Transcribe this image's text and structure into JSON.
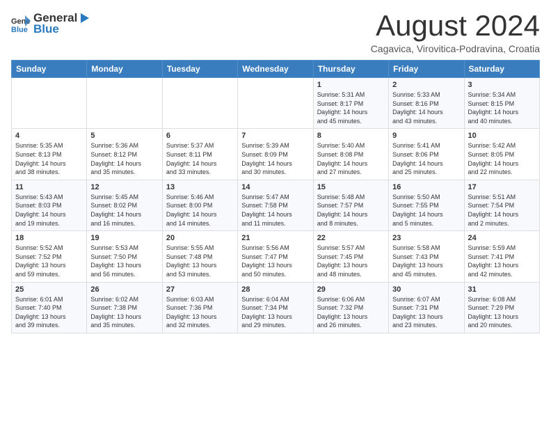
{
  "header": {
    "logo": {
      "text1": "General",
      "text2": "Blue"
    },
    "title": "August 2024",
    "location": "Cagavica, Virovitica-Podravina, Croatia"
  },
  "weekdays": [
    "Sunday",
    "Monday",
    "Tuesday",
    "Wednesday",
    "Thursday",
    "Friday",
    "Saturday"
  ],
  "weeks": [
    [
      {
        "day": "",
        "info": ""
      },
      {
        "day": "",
        "info": ""
      },
      {
        "day": "",
        "info": ""
      },
      {
        "day": "",
        "info": ""
      },
      {
        "day": "1",
        "info": "Sunrise: 5:31 AM\nSunset: 8:17 PM\nDaylight: 14 hours\nand 45 minutes."
      },
      {
        "day": "2",
        "info": "Sunrise: 5:33 AM\nSunset: 8:16 PM\nDaylight: 14 hours\nand 43 minutes."
      },
      {
        "day": "3",
        "info": "Sunrise: 5:34 AM\nSunset: 8:15 PM\nDaylight: 14 hours\nand 40 minutes."
      }
    ],
    [
      {
        "day": "4",
        "info": "Sunrise: 5:35 AM\nSunset: 8:13 PM\nDaylight: 14 hours\nand 38 minutes."
      },
      {
        "day": "5",
        "info": "Sunrise: 5:36 AM\nSunset: 8:12 PM\nDaylight: 14 hours\nand 35 minutes."
      },
      {
        "day": "6",
        "info": "Sunrise: 5:37 AM\nSunset: 8:11 PM\nDaylight: 14 hours\nand 33 minutes."
      },
      {
        "day": "7",
        "info": "Sunrise: 5:39 AM\nSunset: 8:09 PM\nDaylight: 14 hours\nand 30 minutes."
      },
      {
        "day": "8",
        "info": "Sunrise: 5:40 AM\nSunset: 8:08 PM\nDaylight: 14 hours\nand 27 minutes."
      },
      {
        "day": "9",
        "info": "Sunrise: 5:41 AM\nSunset: 8:06 PM\nDaylight: 14 hours\nand 25 minutes."
      },
      {
        "day": "10",
        "info": "Sunrise: 5:42 AM\nSunset: 8:05 PM\nDaylight: 14 hours\nand 22 minutes."
      }
    ],
    [
      {
        "day": "11",
        "info": "Sunrise: 5:43 AM\nSunset: 8:03 PM\nDaylight: 14 hours\nand 19 minutes."
      },
      {
        "day": "12",
        "info": "Sunrise: 5:45 AM\nSunset: 8:02 PM\nDaylight: 14 hours\nand 16 minutes."
      },
      {
        "day": "13",
        "info": "Sunrise: 5:46 AM\nSunset: 8:00 PM\nDaylight: 14 hours\nand 14 minutes."
      },
      {
        "day": "14",
        "info": "Sunrise: 5:47 AM\nSunset: 7:58 PM\nDaylight: 14 hours\nand 11 minutes."
      },
      {
        "day": "15",
        "info": "Sunrise: 5:48 AM\nSunset: 7:57 PM\nDaylight: 14 hours\nand 8 minutes."
      },
      {
        "day": "16",
        "info": "Sunrise: 5:50 AM\nSunset: 7:55 PM\nDaylight: 14 hours\nand 5 minutes."
      },
      {
        "day": "17",
        "info": "Sunrise: 5:51 AM\nSunset: 7:54 PM\nDaylight: 14 hours\nand 2 minutes."
      }
    ],
    [
      {
        "day": "18",
        "info": "Sunrise: 5:52 AM\nSunset: 7:52 PM\nDaylight: 13 hours\nand 59 minutes."
      },
      {
        "day": "19",
        "info": "Sunrise: 5:53 AM\nSunset: 7:50 PM\nDaylight: 13 hours\nand 56 minutes."
      },
      {
        "day": "20",
        "info": "Sunrise: 5:55 AM\nSunset: 7:48 PM\nDaylight: 13 hours\nand 53 minutes."
      },
      {
        "day": "21",
        "info": "Sunrise: 5:56 AM\nSunset: 7:47 PM\nDaylight: 13 hours\nand 50 minutes."
      },
      {
        "day": "22",
        "info": "Sunrise: 5:57 AM\nSunset: 7:45 PM\nDaylight: 13 hours\nand 48 minutes."
      },
      {
        "day": "23",
        "info": "Sunrise: 5:58 AM\nSunset: 7:43 PM\nDaylight: 13 hours\nand 45 minutes."
      },
      {
        "day": "24",
        "info": "Sunrise: 5:59 AM\nSunset: 7:41 PM\nDaylight: 13 hours\nand 42 minutes."
      }
    ],
    [
      {
        "day": "25",
        "info": "Sunrise: 6:01 AM\nSunset: 7:40 PM\nDaylight: 13 hours\nand 39 minutes."
      },
      {
        "day": "26",
        "info": "Sunrise: 6:02 AM\nSunset: 7:38 PM\nDaylight: 13 hours\nand 35 minutes."
      },
      {
        "day": "27",
        "info": "Sunrise: 6:03 AM\nSunset: 7:36 PM\nDaylight: 13 hours\nand 32 minutes."
      },
      {
        "day": "28",
        "info": "Sunrise: 6:04 AM\nSunset: 7:34 PM\nDaylight: 13 hours\nand 29 minutes."
      },
      {
        "day": "29",
        "info": "Sunrise: 6:06 AM\nSunset: 7:32 PM\nDaylight: 13 hours\nand 26 minutes."
      },
      {
        "day": "30",
        "info": "Sunrise: 6:07 AM\nSunset: 7:31 PM\nDaylight: 13 hours\nand 23 minutes."
      },
      {
        "day": "31",
        "info": "Sunrise: 6:08 AM\nSunset: 7:29 PM\nDaylight: 13 hours\nand 20 minutes."
      }
    ]
  ]
}
